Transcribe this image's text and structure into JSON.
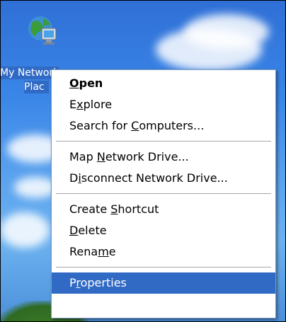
{
  "desktop": {
    "icon_name": "network-places-icon",
    "icon_label_line1": "My Network",
    "icon_label_line2": "Plac"
  },
  "context_menu": {
    "items": [
      {
        "label_pre": "",
        "label_ul": "O",
        "label_post": "pen",
        "bold": true
      },
      {
        "label_pre": "E",
        "label_ul": "x",
        "label_post": "plore"
      },
      {
        "label_pre": "Search for ",
        "label_ul": "C",
        "label_post": "omputers..."
      },
      {
        "label_pre": "Map ",
        "label_ul": "N",
        "label_post": "etwork Drive..."
      },
      {
        "label_pre": "D",
        "label_ul": "i",
        "label_post": "sconnect Network Drive..."
      },
      {
        "label_pre": "Create ",
        "label_ul": "S",
        "label_post": "hortcut"
      },
      {
        "label_pre": "",
        "label_ul": "D",
        "label_post": "elete"
      },
      {
        "label_pre": "Rena",
        "label_ul": "m",
        "label_post": "e"
      },
      {
        "label_pre": "P",
        "label_ul": "r",
        "label_post": "operties",
        "selected": true
      }
    ]
  },
  "colors": {
    "selection": "#316ac5",
    "menu_border": "#7b98c0"
  }
}
